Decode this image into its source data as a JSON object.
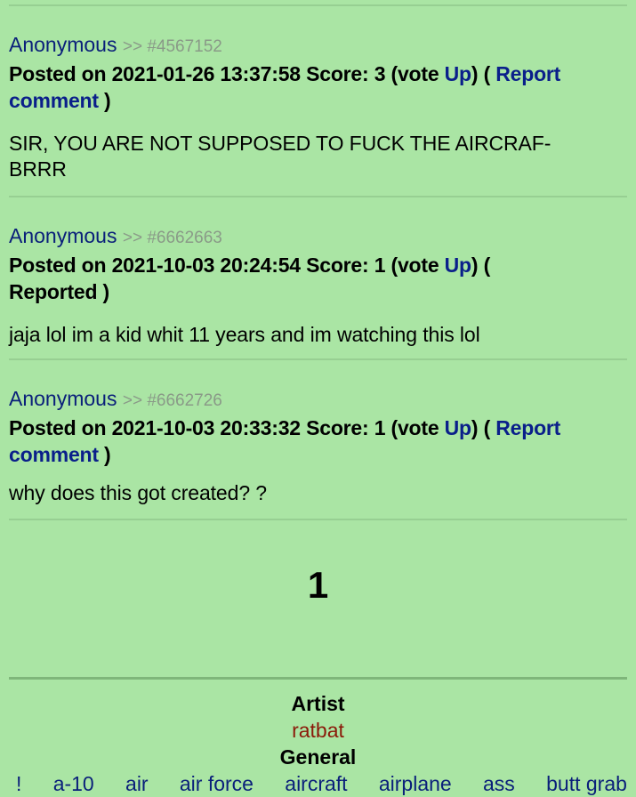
{
  "comments": [
    {
      "author": "Anonymous",
      "ref": ">> #4567152",
      "posted_prefix": "Posted on",
      "datetime": "2021-01-26 13:37:58",
      "score_label": "Score:",
      "score": "3",
      "vote_open": "(vote ",
      "vote_link": "Up",
      "vote_close": ")",
      "report_open": "( ",
      "report_link": "Report comment",
      "report_close": " )",
      "text": "SIR, YOU ARE NOT SUPPOSED TO FUCK THE AIRCRAF- BRRR"
    },
    {
      "author": "Anonymous",
      "ref": ">> #6662663",
      "posted_prefix": "Posted on",
      "datetime": "2021-10-03 20:24:54",
      "score_label": "Score:",
      "score": "1",
      "vote_open": "(vote ",
      "vote_link": "Up",
      "vote_close": ")",
      "report_open": "( ",
      "report_status": "Reported",
      "report_close": " )",
      "text": "jaja lol im a kid whit 11 years and im watching this lol"
    },
    {
      "author": "Anonymous",
      "ref": ">> #6662726",
      "posted_prefix": "Posted on",
      "datetime": "2021-10-03 20:33:32",
      "score_label": "Score:",
      "score": "1",
      "vote_open": "(vote ",
      "vote_link": "Up",
      "vote_close": ")",
      "report_open": "( ",
      "report_link": "Report comment",
      "report_close": " )",
      "text": "why does this got created? ?"
    }
  ],
  "pagination": {
    "current_page": "1"
  },
  "tags": {
    "artist_heading": "Artist",
    "artist": "ratbat",
    "general_heading": "General",
    "general": [
      "!",
      "a-10",
      "air",
      "air force",
      "aircraft",
      "airplane",
      "ass",
      "butt grab"
    ]
  },
  "colors": {
    "background": "#aae5a4",
    "link": "#0a1f7a",
    "artist_link": "#8b1a0a",
    "comment_id": "#8a9a88"
  }
}
